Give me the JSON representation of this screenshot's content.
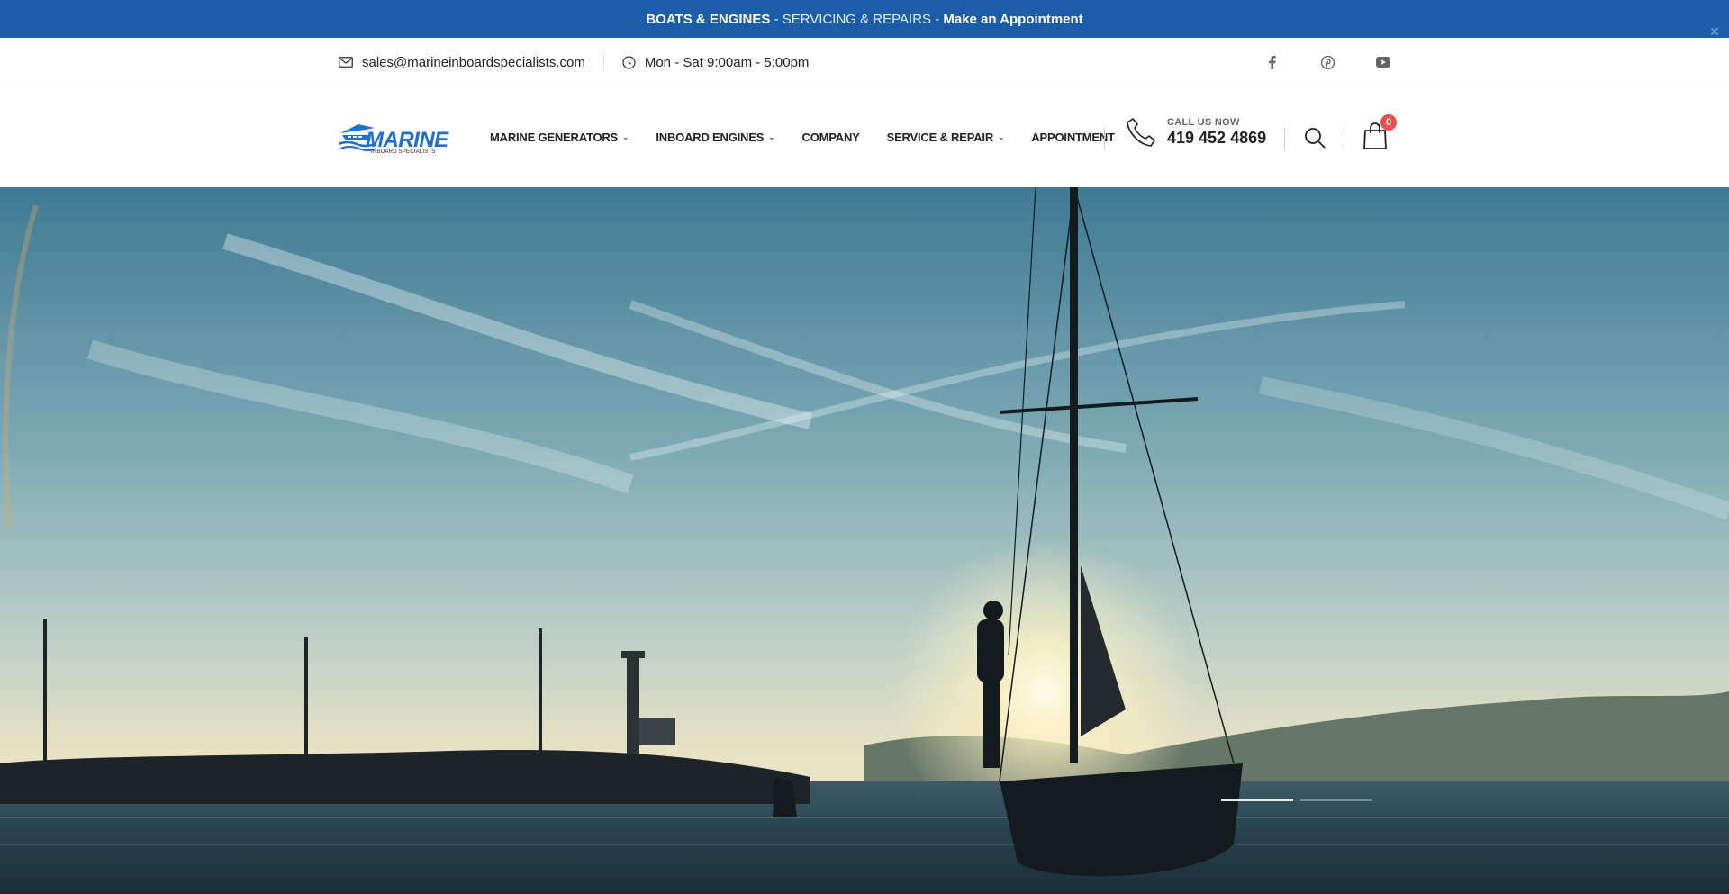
{
  "announcement": {
    "part1": "BOATS & ENGINES",
    "part2": " - SERVICING & REPAIRS - ",
    "link": "Make an Appointment",
    "close_icon": "close-icon"
  },
  "topbar": {
    "email": "sales@marineinboardspecialists.com",
    "hours": "Mon - Sat 9:00am - 5:00pm",
    "socials": [
      "facebook-icon",
      "pinterest-icon",
      "youtube-icon"
    ]
  },
  "logo": {
    "word": "MARINE",
    "tagline": "INBOARD SPECIALISTS"
  },
  "nav": {
    "items": [
      {
        "label": "MARINE GENERATORS",
        "dropdown": true
      },
      {
        "label": "INBOARD ENGINES",
        "dropdown": true
      },
      {
        "label": "COMPANY",
        "dropdown": false
      },
      {
        "label": "SERVICE & REPAIR",
        "dropdown": true
      },
      {
        "label": "APPOINTMENT",
        "dropdown": false
      }
    ]
  },
  "contact": {
    "caption": "CALL US NOW",
    "phone": "419 452 4869"
  },
  "cart": {
    "count": "0"
  },
  "colors": {
    "brand_blue": "#1c5da8",
    "logo_blue": "#1d6fd1",
    "badge_red": "#f04e4e"
  },
  "hero": {
    "slides": 2,
    "active_slide": 1
  }
}
